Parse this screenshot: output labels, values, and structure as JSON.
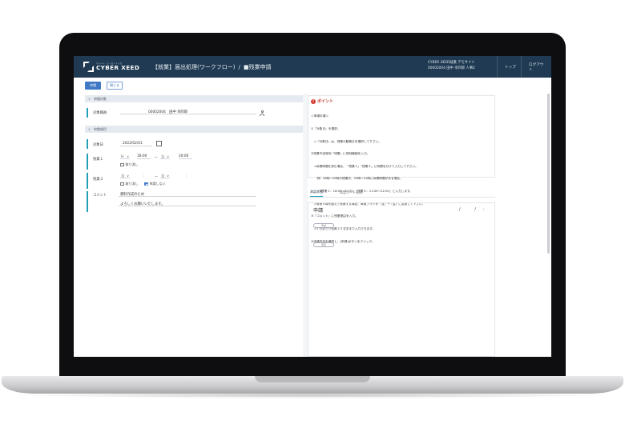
{
  "header": {
    "logo_sub": "サイバー・ヒーローナイズ",
    "logo_name": "CYBER XEED",
    "breadcrumb_main": "【就業】届出処理(ワークフロー)",
    "breadcrumb_sep": "/",
    "breadcrumb_current": "■残業申請",
    "user_line1": "CYBER XEED就業 デモサイト",
    "user_line2": "00002004 田中 幸四郎 人事2",
    "nav_top": "トップ",
    "nav_logout": "ログアウト"
  },
  "toolbar": {
    "apply_label": "申請",
    "close_label": "閉じる"
  },
  "form": {
    "section_target": "申請対象",
    "target_label": "対象職員",
    "target_value": "00002004　田中 幸四郎",
    "section_items": "申請項目",
    "date_label": "対象日",
    "date_value": "2022/02/01",
    "ot1_label": "残業１",
    "ot1_kind": "H",
    "ot1_start": "18:00",
    "ot1_tilde": "〜",
    "ot1_kind2": "当",
    "ot1_end": "20:00",
    "ot1_cancel": "取り消し",
    "ot2_label": "残業２",
    "ot2_kind": "当",
    "ot2_colon1": ":",
    "ot2_tilde": "〜",
    "ot2_kind2": "当",
    "ot2_colon2": ":",
    "ot2_cancel": "取り消し",
    "ot2_no_apply": "申請しない",
    "comment_label": "コメント",
    "comment_line1": "資料作成のため",
    "comment_line2": "よろしくお願いいたします。"
  },
  "point": {
    "icon": "!",
    "title": "ポイント",
    "lines": [
      "＜申請手順＞",
      "①『対象日』を選択。",
      "　⇒『対象日』は、残業の勤務日を選択して下さい。",
      "②残業予定時刻『残業』に時刻範囲を入力。",
      "　⇒休憩時間を挟む場合、『残業１』『残業２』に時間を分けて入力して下さい。",
      "　　例）18時〜20時の残業中、20時〜21時に休憩時間がある場合、",
      "　　　『残業１：18:00〜20:00』『残業２：21:00〜22:00』と入力します。",
      "　⇒深夜０時を超えて残業する場合、時間フラグを『当』→『翌』に変更して下さい。",
      "③『コメント』に残業理由を入力。",
      "　⇒１行あたり全角２０文字まで入力できます。",
      "④申請内容を確認し、[申請]ボタンをクリック。"
    ]
  },
  "tabs": {
    "tab1": "承認状態",
    "tab2": "承認ルート参照"
  },
  "request": {
    "title": "申請",
    "date_slashes": "/ /",
    "colon": ":",
    "pill1": "申請",
    "pill2": "承認"
  },
  "colors": {
    "header_bg": "#1f3a52",
    "accent": "#3f78c4",
    "row_marker": "#22a0b8",
    "point_red": "#d63a2f"
  }
}
